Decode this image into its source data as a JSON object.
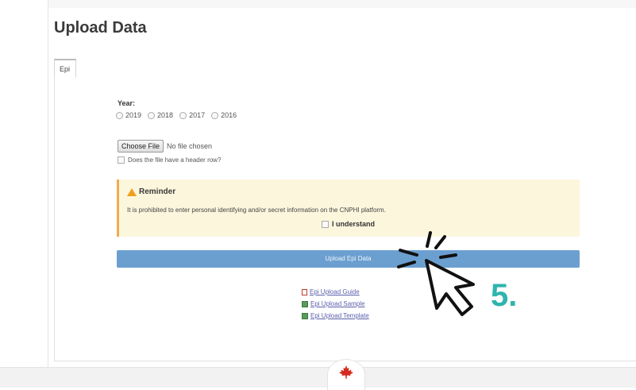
{
  "page": {
    "title": "Upload Data"
  },
  "tabs": [
    {
      "label": "Epi"
    }
  ],
  "form": {
    "year_label": "Year:",
    "years": [
      "2019",
      "2018",
      "2017",
      "2016"
    ],
    "choose_file_label": "Choose File",
    "no_file_text": "No file chosen",
    "header_row_label": "Does the file have a header row?"
  },
  "reminder": {
    "title": "Reminder",
    "text": "It is prohibited to enter personal identifying and/or secret information on the CNPHI platform.",
    "understand_label": "I understand"
  },
  "upload_button": {
    "label": "Upload Epi Data"
  },
  "links": [
    {
      "label": "Epi Upload Guide",
      "icon": "document-icon"
    },
    {
      "label": "Epi Upload Sample",
      "icon": "spreadsheet-icon"
    },
    {
      "label": "Epi Upload Template",
      "icon": "spreadsheet-icon"
    }
  ],
  "annotation": {
    "step": "5."
  },
  "colors": {
    "accent": "#6b9fd0",
    "reminder_bg": "#fcf6dd",
    "warning": "#f0ad4e",
    "step": "#2fb5ad",
    "maple_leaf": "#d52b1e"
  }
}
